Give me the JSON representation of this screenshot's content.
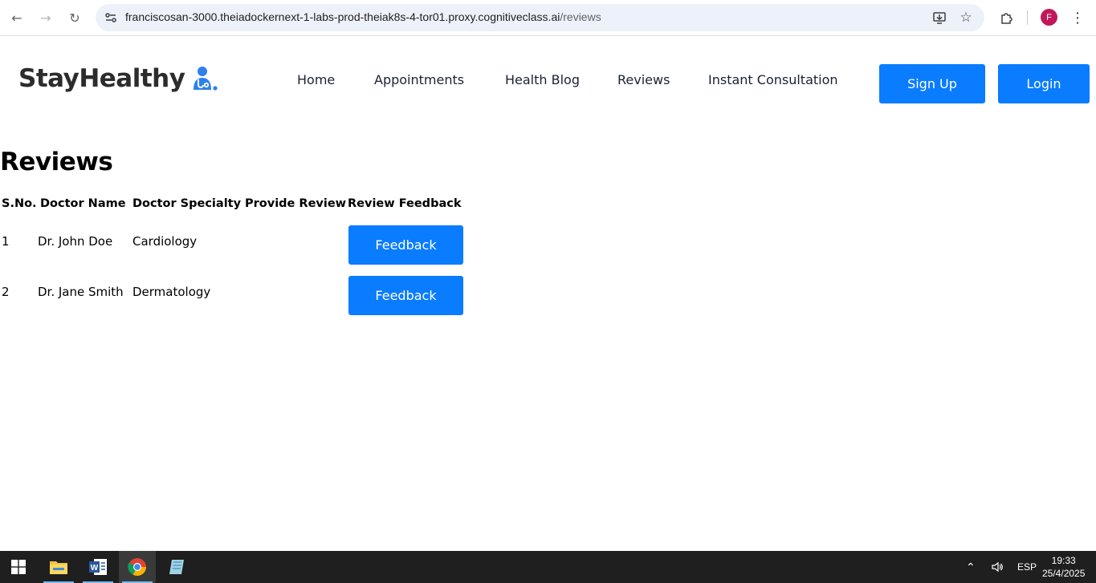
{
  "browser": {
    "url_host": "franciscosan-3000.theiadockernext-1-labs-prod-theiak8s-4-tor01.proxy.cognitiveclass.ai",
    "url_path": "/reviews",
    "profile_initial": "F",
    "profile_color": "#c2185b"
  },
  "header": {
    "logo_text": "StayHealthy",
    "nav": [
      {
        "label": "Home"
      },
      {
        "label": "Appointments"
      },
      {
        "label": "Health Blog"
      },
      {
        "label": "Reviews"
      },
      {
        "label": "Instant Consultation"
      }
    ],
    "signup_label": "Sign Up",
    "login_label": "Login",
    "accent_color": "#0a7cff"
  },
  "main": {
    "title": "Reviews",
    "table": {
      "headers": [
        "S.No.",
        "Doctor Name",
        "Doctor Specialty",
        "Provide Review",
        "Review Feedback"
      ],
      "rows": [
        {
          "sno": "1",
          "doctor": "Dr. John Doe",
          "specialty": "Cardiology",
          "provide": "",
          "action": "Feedback"
        },
        {
          "sno": "2",
          "doctor": "Dr. Jane Smith",
          "specialty": "Dermatology",
          "provide": "",
          "action": "Feedback"
        }
      ]
    }
  },
  "taskbar": {
    "language": "ESP",
    "time": "19:33",
    "date": "25/4/2025",
    "apps": [
      "windows-start-icon",
      "file-explorer-icon",
      "word-icon",
      "chrome-icon",
      "notepad-icon"
    ]
  }
}
